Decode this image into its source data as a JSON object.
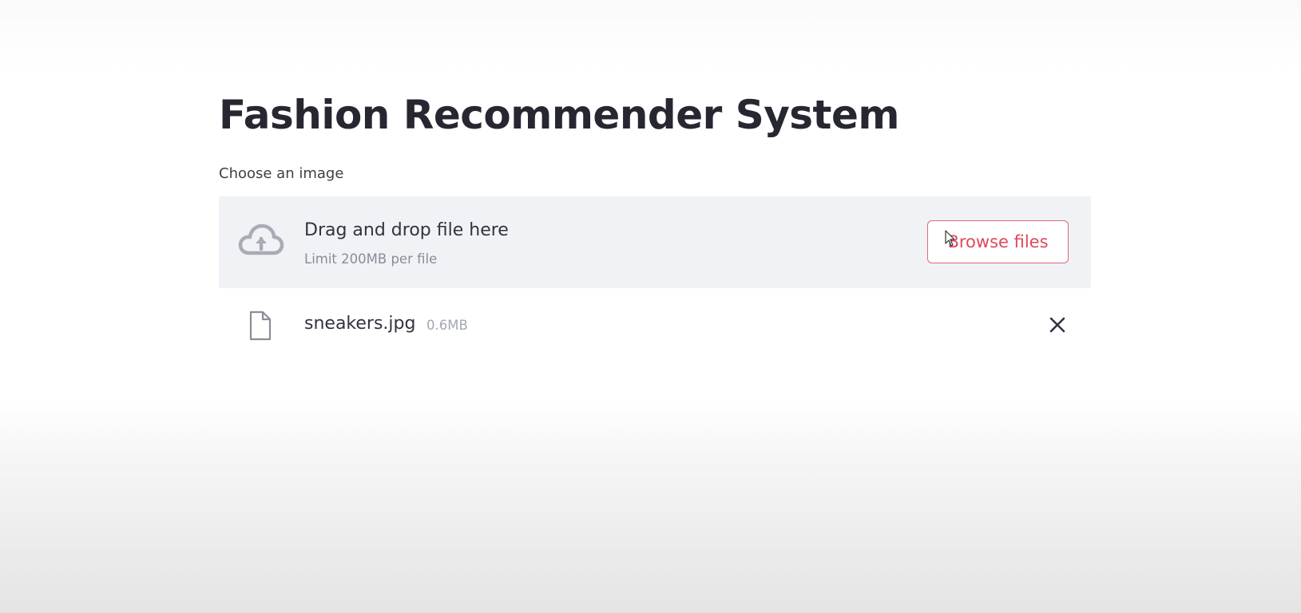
{
  "app": {
    "title": "Fashion Recommender System"
  },
  "uploader": {
    "label": "Choose an image",
    "drop_text": "Drag and drop file here",
    "limit_text": "Limit 200MB per file",
    "browse_label": "Browse files",
    "icon": "cloud-upload-icon"
  },
  "uploaded_file": {
    "name": "sneakers.jpg",
    "size": "0.6MB",
    "icon": "file-icon",
    "remove_icon": "close-icon"
  },
  "colors": {
    "accent": "#e0475e",
    "dropzone_bg": "#f0f2f6",
    "text": "#262730",
    "muted": "#8a8c96"
  }
}
